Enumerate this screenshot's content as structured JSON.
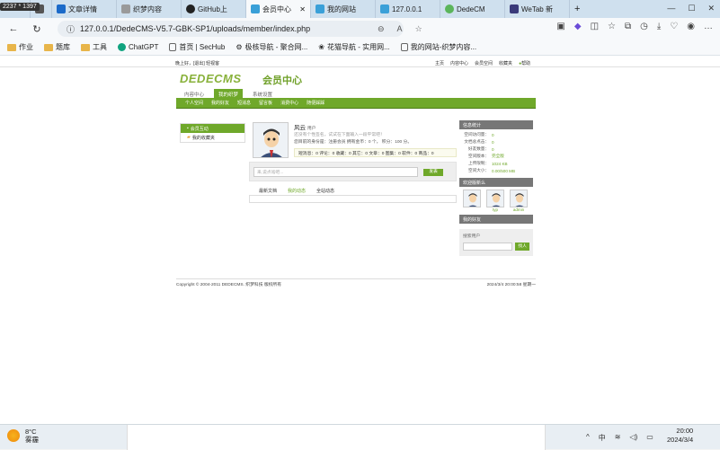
{
  "browser": {
    "resolution_badge": "2237 * 1397",
    "tabs": [
      {
        "label": "文章详情",
        "color": "#1b6ac9"
      },
      {
        "label": "织梦内容",
        "color": "#9a9a9a"
      },
      {
        "label": "GitHub上",
        "color": "#222222"
      },
      {
        "label": "会员中心",
        "color": "#3aa0d8"
      },
      {
        "label": "我的网站",
        "color": "#3aa0d8"
      },
      {
        "label": "127.0.0.1",
        "color": "#3aa0d8"
      },
      {
        "label": "DedeCM",
        "color": "#5bb55b"
      },
      {
        "label": "WeTab 新",
        "color": "#3a3a7a"
      }
    ],
    "url": "127.0.0.1/DedeCMS-V5.7-GBK-SP1/uploads/member/index.php",
    "bookmarks": [
      "作业",
      "题库",
      "工具",
      "ChatGPT",
      "首页 | SecHub",
      "极核导航 - 聚合网...",
      "花猫导航 - 实用网...",
      "我的网站-织梦内容..."
    ]
  },
  "site": {
    "top_left": "晚上好，[退出] 轻视客",
    "top_links": [
      "主页",
      "内容中心",
      "会员空间",
      "收藏夹",
      "帮助"
    ],
    "logo_text": "DEDECMS",
    "logo_sub": "会员中心",
    "main_tabs": [
      "内容中心",
      "我的织梦",
      "系统设置"
    ],
    "nav_items": [
      "个人空间",
      "我的好友",
      "短消息",
      "留言板",
      "消费中心",
      "随便踩踩"
    ],
    "left_menu": [
      "会员互动",
      "我的收藏夹"
    ],
    "user": {
      "name": "风云",
      "role": "用户",
      "signature": "还没有个性签名，试试在下面输入一段平常吧！",
      "status_line": "您目前的身份是：注册会员 拥有金币：0 个， 积分：100 分。",
      "stats": "短消息：0 评论：0 收藏：0 其它：0 文章：0 图集：0 软件：0 商品：0"
    },
    "post_placeholder": "来,说点啥吧...",
    "post_button": "发表",
    "feed_tabs": [
      "最新文档",
      "我的动态",
      "全站动态"
    ],
    "right": {
      "info_title": "信息统计",
      "stats": [
        {
          "k": "空间访问量：",
          "v": "0"
        },
        {
          "k": "文档总点击：",
          "v": "0"
        },
        {
          "k": "好友数量：",
          "v": "0"
        },
        {
          "k": "空间版本：",
          "v": "完全版"
        },
        {
          "k": "上传限制：",
          "v": "1024 KB"
        },
        {
          "k": "空间大小：",
          "v": "0.00/500 MB"
        }
      ],
      "visitors_title": "欢迎版新么",
      "visitors": [
        "",
        "typ",
        "admin"
      ],
      "friends_title": "我的好友",
      "search_label": "搜索用户",
      "search_button": "找人"
    },
    "footer_left": "Copyright © 2004-2011 DEDECMS. 织梦科技 版权所有",
    "footer_right": "2024/3/4 20:00:58 星期一"
  },
  "taskbar": {
    "temp": "8°C",
    "weather": "雾霾",
    "ime": "中",
    "time": "20:00",
    "date": "2024/3/4"
  }
}
